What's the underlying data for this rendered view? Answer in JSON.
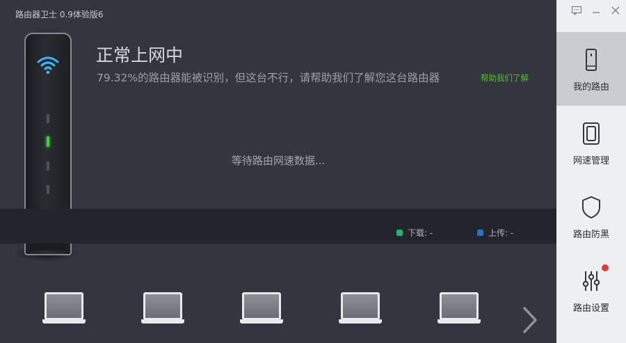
{
  "app_title": "路由器卫士 0.9体验版6",
  "status": {
    "title": "正常上网中",
    "description": "79.32%的路由器能被识别，但这台不行，请帮助我们了解您这台路由器",
    "help_link": "帮助我们了解"
  },
  "speed": {
    "waiting_text": "等待路由网速数据...",
    "download_label": "下载: -",
    "upload_label": "上传: -",
    "download_color": "#23b26d",
    "upload_color": "#2f6fc4"
  },
  "router_leds": [
    "off",
    "on",
    "off",
    "off"
  ],
  "devices_count": 5,
  "sidebar": {
    "items": [
      {
        "label": "我的路由",
        "icon": "router-icon",
        "active": true
      },
      {
        "label": "网速管理",
        "icon": "speed-icon",
        "active": false
      },
      {
        "label": "路由防黑",
        "icon": "shield-icon",
        "active": false
      },
      {
        "label": "路由设置",
        "icon": "sliders-icon",
        "active": false
      }
    ]
  },
  "window_buttons": [
    "feedback-icon",
    "minimize-icon",
    "close-icon"
  ],
  "colors": {
    "background": "#33363f",
    "sidebar": "#eef0f2",
    "accent_green": "#54c11b",
    "led_green": "#3fd13a",
    "badge_red": "#e03a3a"
  }
}
